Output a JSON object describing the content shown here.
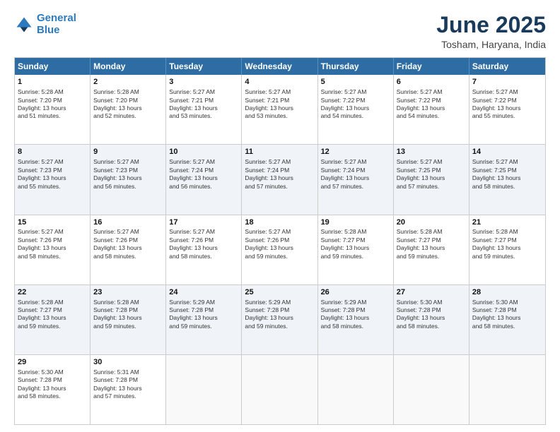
{
  "header": {
    "logo_line1": "General",
    "logo_line2": "Blue",
    "month_title": "June 2025",
    "location": "Tosham, Haryana, India"
  },
  "days_of_week": [
    "Sunday",
    "Monday",
    "Tuesday",
    "Wednesday",
    "Thursday",
    "Friday",
    "Saturday"
  ],
  "rows": [
    [
      {
        "day": "1",
        "lines": [
          "Sunrise: 5:28 AM",
          "Sunset: 7:20 PM",
          "Daylight: 13 hours",
          "and 51 minutes."
        ]
      },
      {
        "day": "2",
        "lines": [
          "Sunrise: 5:28 AM",
          "Sunset: 7:20 PM",
          "Daylight: 13 hours",
          "and 52 minutes."
        ]
      },
      {
        "day": "3",
        "lines": [
          "Sunrise: 5:27 AM",
          "Sunset: 7:21 PM",
          "Daylight: 13 hours",
          "and 53 minutes."
        ]
      },
      {
        "day": "4",
        "lines": [
          "Sunrise: 5:27 AM",
          "Sunset: 7:21 PM",
          "Daylight: 13 hours",
          "and 53 minutes."
        ]
      },
      {
        "day": "5",
        "lines": [
          "Sunrise: 5:27 AM",
          "Sunset: 7:22 PM",
          "Daylight: 13 hours",
          "and 54 minutes."
        ]
      },
      {
        "day": "6",
        "lines": [
          "Sunrise: 5:27 AM",
          "Sunset: 7:22 PM",
          "Daylight: 13 hours",
          "and 54 minutes."
        ]
      },
      {
        "day": "7",
        "lines": [
          "Sunrise: 5:27 AM",
          "Sunset: 7:22 PM",
          "Daylight: 13 hours",
          "and 55 minutes."
        ]
      }
    ],
    [
      {
        "day": "8",
        "lines": [
          "Sunrise: 5:27 AM",
          "Sunset: 7:23 PM",
          "Daylight: 13 hours",
          "and 55 minutes."
        ]
      },
      {
        "day": "9",
        "lines": [
          "Sunrise: 5:27 AM",
          "Sunset: 7:23 PM",
          "Daylight: 13 hours",
          "and 56 minutes."
        ]
      },
      {
        "day": "10",
        "lines": [
          "Sunrise: 5:27 AM",
          "Sunset: 7:24 PM",
          "Daylight: 13 hours",
          "and 56 minutes."
        ]
      },
      {
        "day": "11",
        "lines": [
          "Sunrise: 5:27 AM",
          "Sunset: 7:24 PM",
          "Daylight: 13 hours",
          "and 57 minutes."
        ]
      },
      {
        "day": "12",
        "lines": [
          "Sunrise: 5:27 AM",
          "Sunset: 7:24 PM",
          "Daylight: 13 hours",
          "and 57 minutes."
        ]
      },
      {
        "day": "13",
        "lines": [
          "Sunrise: 5:27 AM",
          "Sunset: 7:25 PM",
          "Daylight: 13 hours",
          "and 57 minutes."
        ]
      },
      {
        "day": "14",
        "lines": [
          "Sunrise: 5:27 AM",
          "Sunset: 7:25 PM",
          "Daylight: 13 hours",
          "and 58 minutes."
        ]
      }
    ],
    [
      {
        "day": "15",
        "lines": [
          "Sunrise: 5:27 AM",
          "Sunset: 7:26 PM",
          "Daylight: 13 hours",
          "and 58 minutes."
        ]
      },
      {
        "day": "16",
        "lines": [
          "Sunrise: 5:27 AM",
          "Sunset: 7:26 PM",
          "Daylight: 13 hours",
          "and 58 minutes."
        ]
      },
      {
        "day": "17",
        "lines": [
          "Sunrise: 5:27 AM",
          "Sunset: 7:26 PM",
          "Daylight: 13 hours",
          "and 58 minutes."
        ]
      },
      {
        "day": "18",
        "lines": [
          "Sunrise: 5:27 AM",
          "Sunset: 7:26 PM",
          "Daylight: 13 hours",
          "and 59 minutes."
        ]
      },
      {
        "day": "19",
        "lines": [
          "Sunrise: 5:28 AM",
          "Sunset: 7:27 PM",
          "Daylight: 13 hours",
          "and 59 minutes."
        ]
      },
      {
        "day": "20",
        "lines": [
          "Sunrise: 5:28 AM",
          "Sunset: 7:27 PM",
          "Daylight: 13 hours",
          "and 59 minutes."
        ]
      },
      {
        "day": "21",
        "lines": [
          "Sunrise: 5:28 AM",
          "Sunset: 7:27 PM",
          "Daylight: 13 hours",
          "and 59 minutes."
        ]
      }
    ],
    [
      {
        "day": "22",
        "lines": [
          "Sunrise: 5:28 AM",
          "Sunset: 7:27 PM",
          "Daylight: 13 hours",
          "and 59 minutes."
        ]
      },
      {
        "day": "23",
        "lines": [
          "Sunrise: 5:28 AM",
          "Sunset: 7:28 PM",
          "Daylight: 13 hours",
          "and 59 minutes."
        ]
      },
      {
        "day": "24",
        "lines": [
          "Sunrise: 5:29 AM",
          "Sunset: 7:28 PM",
          "Daylight: 13 hours",
          "and 59 minutes."
        ]
      },
      {
        "day": "25",
        "lines": [
          "Sunrise: 5:29 AM",
          "Sunset: 7:28 PM",
          "Daylight: 13 hours",
          "and 59 minutes."
        ]
      },
      {
        "day": "26",
        "lines": [
          "Sunrise: 5:29 AM",
          "Sunset: 7:28 PM",
          "Daylight: 13 hours",
          "and 58 minutes."
        ]
      },
      {
        "day": "27",
        "lines": [
          "Sunrise: 5:30 AM",
          "Sunset: 7:28 PM",
          "Daylight: 13 hours",
          "and 58 minutes."
        ]
      },
      {
        "day": "28",
        "lines": [
          "Sunrise: 5:30 AM",
          "Sunset: 7:28 PM",
          "Daylight: 13 hours",
          "and 58 minutes."
        ]
      }
    ],
    [
      {
        "day": "29",
        "lines": [
          "Sunrise: 5:30 AM",
          "Sunset: 7:28 PM",
          "Daylight: 13 hours",
          "and 58 minutes."
        ]
      },
      {
        "day": "30",
        "lines": [
          "Sunrise: 5:31 AM",
          "Sunset: 7:28 PM",
          "Daylight: 13 hours",
          "and 57 minutes."
        ]
      },
      {
        "day": "",
        "lines": []
      },
      {
        "day": "",
        "lines": []
      },
      {
        "day": "",
        "lines": []
      },
      {
        "day": "",
        "lines": []
      },
      {
        "day": "",
        "lines": []
      }
    ]
  ]
}
